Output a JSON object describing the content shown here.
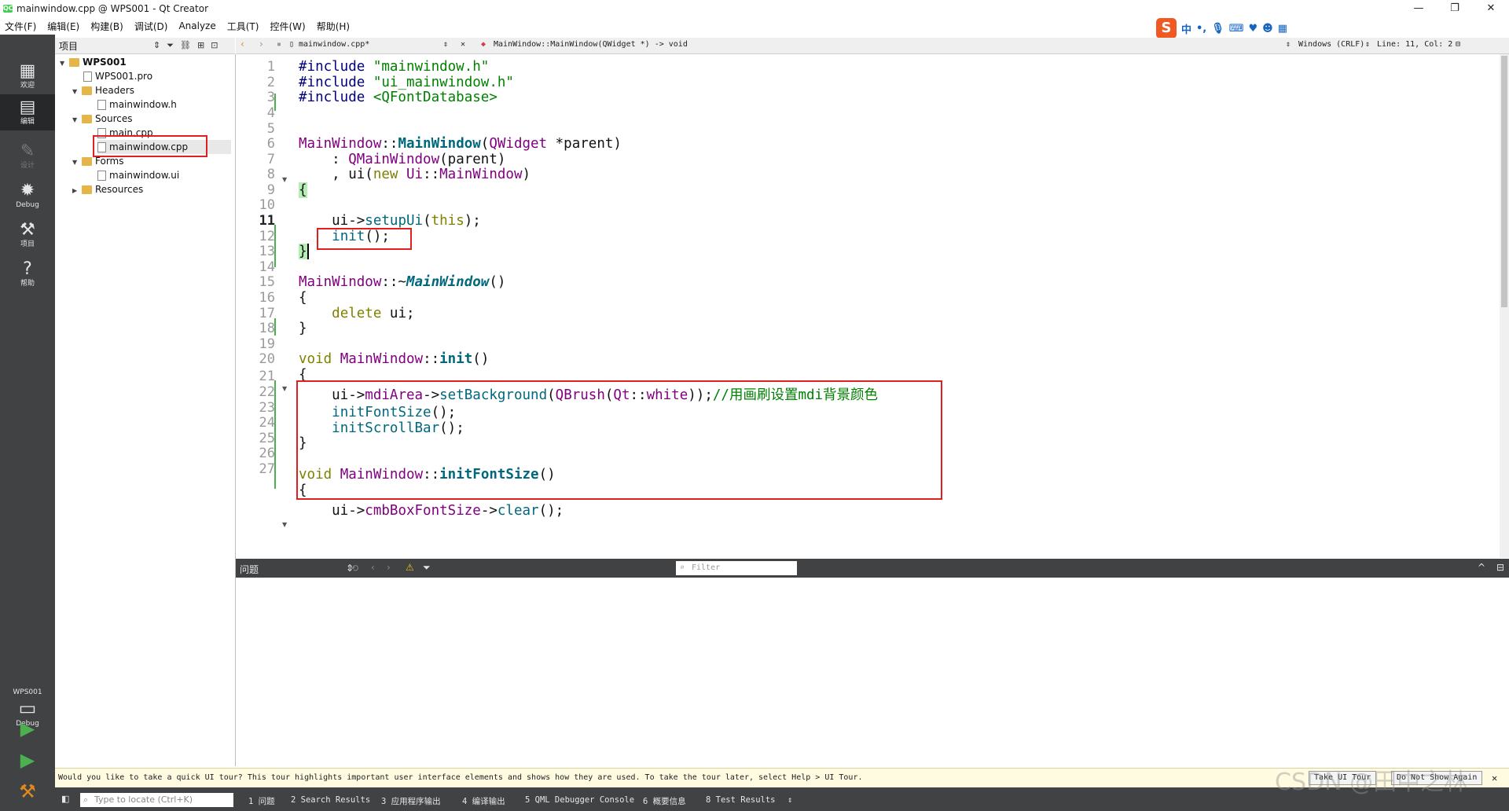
{
  "window": {
    "title": "mainwindow.cpp @ WPS001 - Qt Creator",
    "app_icon": "QC",
    "controls": [
      "—",
      "❐",
      "✕"
    ]
  },
  "menu": [
    "文件(F)",
    "编辑(E)",
    "构建(B)",
    "调试(D)",
    "Analyze",
    "工具(T)",
    "控件(W)",
    "帮助(H)"
  ],
  "ime": {
    "logo": "S",
    "mode": "中"
  },
  "modes": [
    {
      "label": "欢迎",
      "icon": "grid-icon",
      "glyph": "▦"
    },
    {
      "label": "编辑",
      "icon": "edit-icon",
      "glyph": "▤"
    },
    {
      "label": "设计",
      "icon": "pencil-icon",
      "glyph": "✎"
    },
    {
      "label": "Debug",
      "icon": "bug-icon",
      "glyph": "✹"
    },
    {
      "label": "项目",
      "icon": "wrench-icon",
      "glyph": "⚒"
    },
    {
      "label": "帮助",
      "icon": "help-icon",
      "glyph": "?"
    }
  ],
  "kit": {
    "project": "WPS001",
    "mode": "Debug",
    "monitor": "▭"
  },
  "project_pane": {
    "title": "项目",
    "tree": [
      {
        "label": "WPS001",
        "kind": "project"
      },
      {
        "label": "WPS001.pro",
        "kind": "file"
      },
      {
        "label": "Headers",
        "kind": "folder"
      },
      {
        "label": "mainwindow.h",
        "kind": "file"
      },
      {
        "label": "Sources",
        "kind": "folder"
      },
      {
        "label": "main.cpp",
        "kind": "file"
      },
      {
        "label": "mainwindow.cpp",
        "kind": "file"
      },
      {
        "label": "Forms",
        "kind": "folder"
      },
      {
        "label": "mainwindow.ui",
        "kind": "file"
      },
      {
        "label": "Resources",
        "kind": "folder"
      }
    ]
  },
  "editor_toolbar": {
    "file": "mainwindow.cpp*",
    "symbol": "MainWindow::MainWindow(QWidget *) -> void",
    "encoding": "Windows (CRLF)",
    "position": "Line: 11, Col: 2"
  },
  "line_numbers": [
    "1",
    "2",
    "3",
    "4",
    "5",
    "6",
    "7",
    "8",
    "9",
    "10",
    "11",
    "12",
    "13",
    "14",
    "15",
    "16",
    "17",
    "18",
    "19",
    "20",
    "21",
    "22",
    "23",
    "24",
    "25",
    "26",
    "27"
  ],
  "current_line": 11,
  "code": {
    "l1": {
      "a": "#include ",
      "b": "\"mainwindow.h\""
    },
    "l2": {
      "a": "#include ",
      "b": "\"ui_mainwindow.h\""
    },
    "l3": {
      "a": "#include ",
      "b": "<QFontDatabase>"
    },
    "l5": {
      "a": "MainWindow",
      "b": "::",
      "c": "MainWindow",
      "d": "(",
      "e": "QWidget",
      "f": " *parent)"
    },
    "l6": {
      "a": "    : ",
      "b": "QMainWindow",
      "c": "(parent)"
    },
    "l7": {
      "a": "    , ui(",
      "b": "new",
      "c": " ",
      "d": "Ui",
      "e": "::",
      "f": "MainWindow",
      "g": ")"
    },
    "l8": {
      "a": "{"
    },
    "l9": {
      "a": "    ui->",
      "b": "setupUi",
      "c": "(",
      "d": "this",
      "e": ");"
    },
    "l10": {
      "a": "    ",
      "b": "init",
      "c": "();"
    },
    "l11": {
      "a": "}"
    },
    "l13": {
      "a": "MainWindow",
      "b": "::~",
      "c": "MainWindow",
      "d": "()"
    },
    "l14": {
      "a": "{"
    },
    "l15": {
      "a": "    ",
      "b": "delete",
      "c": " ui;"
    },
    "l16": {
      "a": "}"
    },
    "l18": {
      "a": "void",
      "b": " ",
      "c": "MainWindow",
      "d": "::",
      "e": "init",
      "f": "()"
    },
    "l19": {
      "a": "{"
    },
    "l20": {
      "a": "    ui->",
      "b": "mdiArea",
      "c": "->",
      "d": "setBackground",
      "e": "(",
      "f": "QBrush",
      "g": "(",
      "h": "Qt",
      "i": "::",
      "j": "white",
      "k": "));",
      "l": "//用画刷设置mdi背景颜色"
    },
    "l21": {
      "a": "    ",
      "b": "initFontSize",
      "c": "();"
    },
    "l22": {
      "a": "    ",
      "b": "initScrollBar",
      "c": "();"
    },
    "l23": {
      "a": "}"
    },
    "l25": {
      "a": "void",
      "b": " ",
      "c": "MainWindow",
      "d": "::",
      "e": "initFontSize",
      "f": "()"
    },
    "l26": {
      "a": "{"
    },
    "l27": {
      "a": "    ui->",
      "b": "cmbBoxFontSize",
      "c": "->",
      "d": "clear",
      "e": "();"
    }
  },
  "issues": {
    "title": "问题",
    "filter_placeholder": "Filter"
  },
  "tour": {
    "message": "Would you like to take a quick UI tour? This tour highlights important user interface elements and shows how they are used. To take the tour later, select Help > UI Tour.",
    "take": "Take UI Tour",
    "dismiss": "Do Not Show Again"
  },
  "status": {
    "locate_placeholder": "Type to locate (Ctrl+K)",
    "tabs": [
      "1 问题",
      "2 Search Results",
      "3 应用程序输出",
      "4 编译输出",
      "5 QML Debugger Console",
      "6 概要信息",
      "8 Test Results"
    ]
  },
  "watermark": "CSDN @田中之林",
  "colors": {
    "keyword": "#808000",
    "string": "#008000",
    "type": "#800080",
    "function": "#00677c",
    "highlight": "#e02020"
  }
}
